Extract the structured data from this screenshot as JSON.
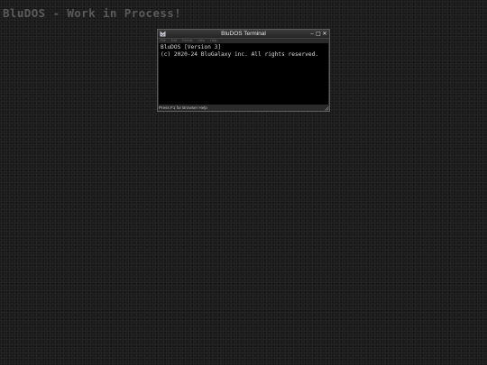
{
  "desktop": {
    "title": "BluDOS - Work in Process!"
  },
  "window": {
    "title": "BluDOS Terminal",
    "app_icon": "bludos-logo-icon",
    "controls": {
      "minimize": "‒",
      "maximize": "□",
      "close": "✕"
    },
    "menu": [
      "File",
      "Edit",
      "Format",
      "View",
      "Help"
    ],
    "console_lines": [
      "BluDOS [Version 3]",
      "(c) 2020-24 BluGalaxy inc. All rights reserved."
    ],
    "status_text": "Press F1 for Browser Help"
  },
  "colors": {
    "desktop_background": "#1b1b1b",
    "window_chrome": "#2b2b2b",
    "console_background": "#000000",
    "console_text": "#dcdcdc",
    "desktop_title_text": "#5a5a5a"
  }
}
